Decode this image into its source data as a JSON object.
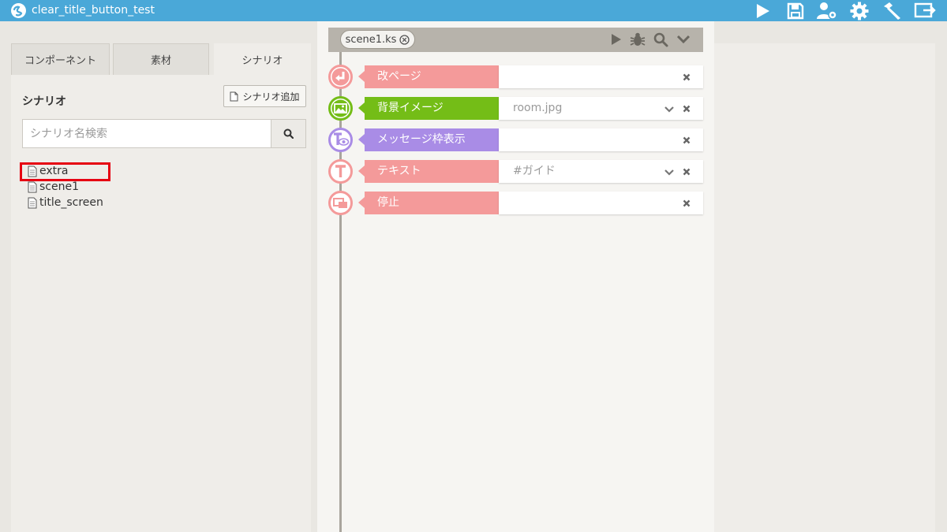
{
  "window": {
    "title": "clear_title_button_test"
  },
  "titlebar_icons": [
    "play-icon",
    "save-icon",
    "user-settings-icon",
    "gear-icon",
    "hammer-icon",
    "export-icon"
  ],
  "left_panel": {
    "tabs": [
      {
        "label": "コンポーネント",
        "active": false
      },
      {
        "label": "素材",
        "active": false
      },
      {
        "label": "シナリオ",
        "active": true
      }
    ],
    "section_title": "シナリオ",
    "add_button_label": "シナリオ追加",
    "search": {
      "placeholder": "シナリオ名検索",
      "value": ""
    },
    "files": [
      "extra",
      "scene1",
      "title_screen"
    ]
  },
  "editor": {
    "file_tab_label": "scene1.ks",
    "toolbar_icons": [
      "play-icon",
      "bug-icon",
      "search-icon",
      "chevron-down-icon"
    ],
    "rows": [
      {
        "label": "改ページ",
        "value": "",
        "color": "#f49a9a",
        "icon": "page-break-icon",
        "has_dropdown": false
      },
      {
        "label": "背景イメージ",
        "value": "room.jpg",
        "color": "#74bd17",
        "icon": "background-image-icon",
        "has_dropdown": true
      },
      {
        "label": "メッセージ枠表示",
        "value": "",
        "color": "#a98ce6",
        "icon": "message-window-show-icon",
        "has_dropdown": false
      },
      {
        "label": "テキスト",
        "value": "#ガイド",
        "color": "#f49a9a",
        "icon": "text-icon",
        "has_dropdown": true
      },
      {
        "label": "停止",
        "value": "",
        "color": "#f49a9a",
        "icon": "stop-icon",
        "has_dropdown": false
      }
    ]
  },
  "colors": {
    "titlebar": "#4aa8d8",
    "highlight": "#e60012",
    "timeline": "#a9a59d"
  }
}
